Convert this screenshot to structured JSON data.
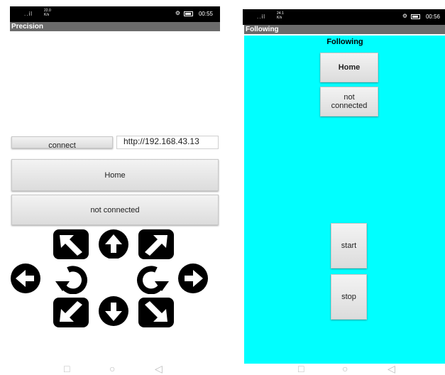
{
  "left": {
    "status": {
      "signal": "..il",
      "net_top": "22.0",
      "net_bottom": "K/s",
      "time": "00:55"
    },
    "title": "Precision",
    "connect_label": "connect",
    "url_value": "http://192.168.43.13",
    "home_label": "Home",
    "connection_status": "not connected"
  },
  "right": {
    "status": {
      "signal": "..il",
      "net_top": "24.1",
      "net_bottom": "K/s",
      "time": "00:56"
    },
    "title": "Following",
    "heading": "Following",
    "home_label": "Home",
    "connection_status": "not connected",
    "start_label": "start",
    "stop_label": "stop"
  },
  "icons": [
    "arrow-up-left-icon",
    "arrow-up-icon",
    "arrow-up-right-icon",
    "arrow-left-icon",
    "rotate-left-icon",
    "rotate-right-icon",
    "arrow-right-icon",
    "arrow-down-left-icon",
    "arrow-down-icon",
    "arrow-down-right-icon"
  ],
  "colors": {
    "cyan_background": "#00ffff",
    "titlebar": "#6b6b6b",
    "statusbar": "#000000"
  }
}
